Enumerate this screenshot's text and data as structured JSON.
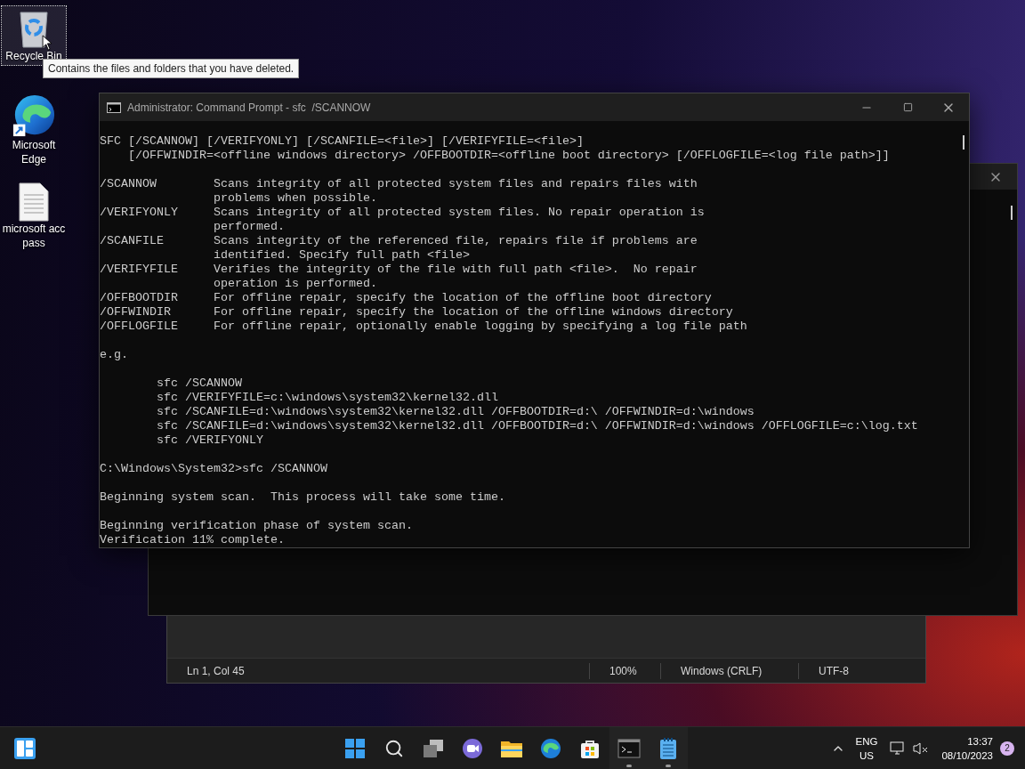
{
  "desktop_icons": [
    {
      "label": "Recycle Bin",
      "selected": true
    },
    {
      "label": "Microsoft Edge",
      "selected": false
    },
    {
      "label": "microsoft acc pass",
      "selected": false
    }
  ],
  "tooltip": {
    "text": "Contains the files and folders that you have deleted."
  },
  "cmd_window": {
    "title": "Administrator: Command Prompt - sfc  /SCANNOW",
    "output": [
      [
        "SFC [/SCANNOW] [/VERIFYONLY] [/SCANFILE=<file>] [/VERIFYFILE=<file>]",
        "    [/OFFWINDIR=<offline windows directory> /OFFBOOTDIR=<offline boot directory> [/OFFLOGFILE=<log file path>]]"
      ],
      [
        "/SCANNOW        Scans integrity of all protected system files and repairs files with",
        "                problems when possible.",
        "/VERIFYONLY     Scans integrity of all protected system files. No repair operation is",
        "                performed.",
        "/SCANFILE       Scans integrity of the referenced file, repairs file if problems are",
        "                identified. Specify full path <file>",
        "/VERIFYFILE     Verifies the integrity of the file with full path <file>.  No repair",
        "                operation is performed.",
        "/OFFBOOTDIR     For offline repair, specify the location of the offline boot directory",
        "/OFFWINDIR      For offline repair, specify the location of the offline windows directory",
        "/OFFLOGFILE     For offline repair, optionally enable logging by specifying a log file path"
      ],
      [
        "e.g."
      ],
      [
        "        sfc /SCANNOW",
        "        sfc /VERIFYFILE=c:\\windows\\system32\\kernel32.dll",
        "        sfc /SCANFILE=d:\\windows\\system32\\kernel32.dll /OFFBOOTDIR=d:\\ /OFFWINDIR=d:\\windows",
        "        sfc /SCANFILE=d:\\windows\\system32\\kernel32.dll /OFFBOOTDIR=d:\\ /OFFWINDIR=d:\\windows /OFFLOGFILE=c:\\log.txt",
        "        sfc /VERIFYONLY"
      ],
      [
        "C:\\Windows\\System32>sfc /SCANNOW"
      ],
      [
        "Beginning system scan.  This process will take some time."
      ],
      [
        "Beginning verification phase of system scan.",
        "Verification 11% complete."
      ]
    ]
  },
  "notepad": {
    "status_bar": [
      "Ln 1, Col 45",
      "100%",
      "Windows (CRLF)",
      "UTF-8"
    ]
  },
  "taskbar": {
    "apps": [
      {
        "running": false
      },
      {
        "running": false
      },
      {
        "running": false
      },
      {
        "running": false
      },
      {
        "running": false
      },
      {
        "running": false
      },
      {
        "running": false
      },
      {
        "running": true
      },
      {
        "running": true
      }
    ],
    "language": [
      "ENG",
      "US"
    ],
    "time": "13:37",
    "date": "08/10/2023",
    "notification_count": "2"
  }
}
